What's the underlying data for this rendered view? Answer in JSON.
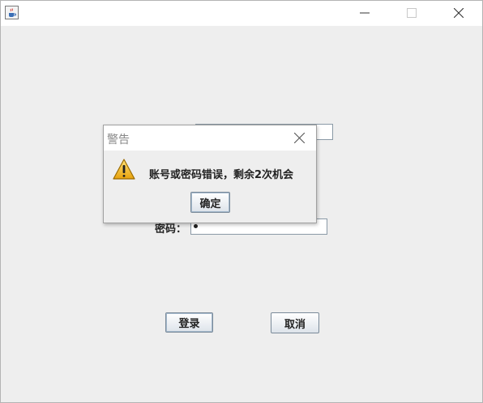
{
  "window": {
    "icon": "java-cup-icon",
    "controls": [
      "minimize-icon",
      "maximize-icon",
      "close-icon"
    ]
  },
  "form": {
    "password_label": "密码：",
    "password_value": "•",
    "login_label": "登录",
    "cancel_label": "取消"
  },
  "dialog": {
    "title": "警告",
    "icon": "warning-icon",
    "message": "账号或密码错误，剩余2次机会",
    "ok_label": "确定"
  }
}
